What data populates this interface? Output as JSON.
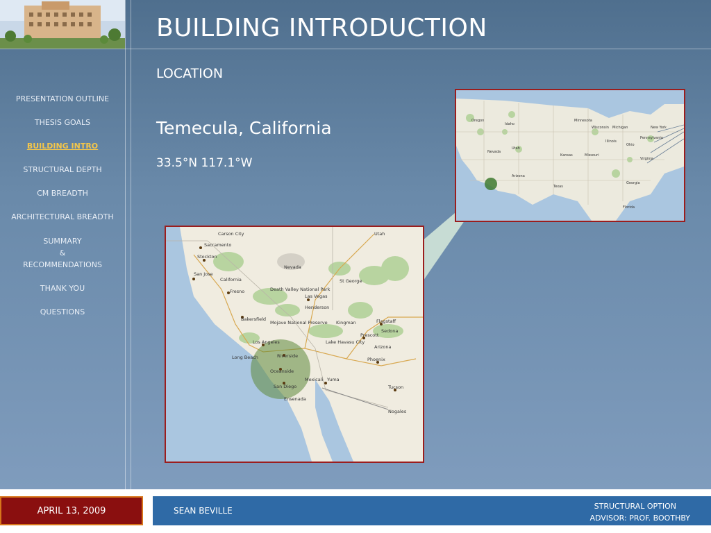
{
  "slide": {
    "title": "BUILDING INTRODUCTION",
    "subtitle": "LOCATION",
    "city": "Temecula, California",
    "coords": "33.5°N 117.1°W"
  },
  "nav": [
    {
      "label": "PRESENTATION OUTLINE"
    },
    {
      "label": "THESIS GOALS"
    },
    {
      "label": "BUILDING INTRO",
      "active": true
    },
    {
      "label": "STRUCTURAL DEPTH"
    },
    {
      "label": "CM BREADTH"
    },
    {
      "label": "ARCHITECTURAL BREADTH"
    },
    {
      "label_lines": [
        "SUMMARY",
        "&",
        "RECOMMENDATIONS"
      ]
    },
    {
      "label": "THANK YOU"
    },
    {
      "label": "QUESTIONS"
    }
  ],
  "map_small_labels": [
    "Oregon",
    "Idaho",
    "Nevada",
    "Utah",
    "Arizona",
    "Texas",
    "Kansas",
    "Missouri",
    "Illinois",
    "Ohio",
    "Virginia",
    "Georgia",
    "Florida",
    "Michigan",
    "Pennsylvania",
    "New York",
    "Minnesota",
    "Wisconsin"
  ],
  "map_large_labels": [
    "Sacramento",
    "Stockton",
    "San Jose",
    "Fresno",
    "California",
    "Bakersfield",
    "Las Vegas",
    "Los Angeles",
    "Riverside",
    "Oceanside",
    "San Diego",
    "Yuma",
    "Phoenix",
    "Arizona",
    "Tucson",
    "Flagstaff",
    "Prescott",
    "Utah",
    "Nevada",
    "Death Valley National Park",
    "Mojave National Preserve",
    "Long Beach",
    "Ensenada",
    "Mexicali",
    "St George",
    "Henderson",
    "Lake Havasu City",
    "Kingman",
    "Carson City",
    "Sedona",
    "Nogales"
  ],
  "footer": {
    "date": "APRIL 13, 2009",
    "name": "SEAN BEVILLE",
    "option": "STRUCTURAL OPTION",
    "advisor": "ADVISOR:  PROF. BOOTHBY"
  },
  "colors": {
    "frame_red": "#9b1d1d",
    "nav_active": "#f3c64a",
    "footer_blue": "#2f6aa6",
    "footer_date_bg": "#8a0f0f"
  }
}
